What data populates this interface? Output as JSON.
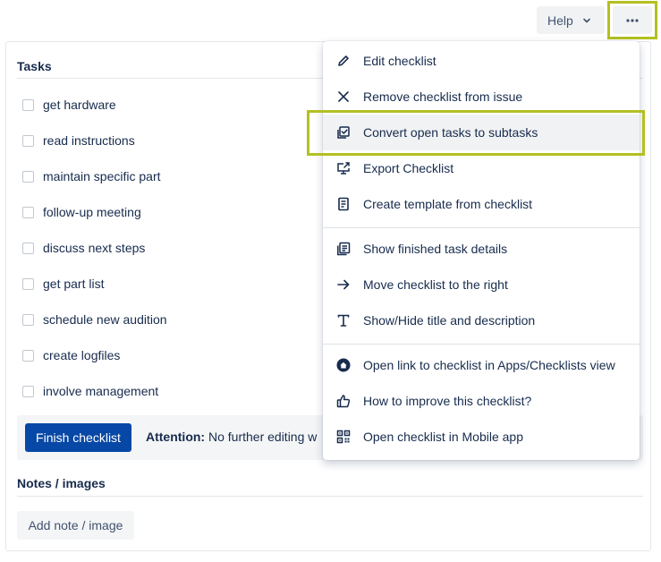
{
  "header": {
    "help_label": "Help",
    "more_icon": "ellipsis-icon"
  },
  "checklist": {
    "tasks_title": "Tasks",
    "tasks": [
      {
        "label": "get hardware",
        "checked": false
      },
      {
        "label": "read instructions",
        "checked": false
      },
      {
        "label": "maintain specific part",
        "checked": false
      },
      {
        "label": "follow-up meeting",
        "checked": false
      },
      {
        "label": "discuss next steps",
        "checked": false
      },
      {
        "label": "get part list",
        "checked": false
      },
      {
        "label": "schedule new audition",
        "checked": false
      },
      {
        "label": "create logfiles",
        "checked": false
      },
      {
        "label": "involve management",
        "checked": false
      }
    ],
    "finish_label": "Finish checklist",
    "attention_label": "Attention:",
    "attention_text": "No further editing w",
    "notes_title": "Notes / images",
    "add_note_label": "Add note / image"
  },
  "menu": {
    "items": [
      {
        "label": "Edit checklist",
        "icon": "pencil-icon"
      },
      {
        "label": "Remove checklist from issue",
        "icon": "close-icon"
      },
      {
        "label": "Convert open tasks to subtasks",
        "icon": "subtasks-icon",
        "highlighted": true
      },
      {
        "label": "Export Checklist",
        "icon": "export-icon"
      },
      {
        "label": "Create template from checklist",
        "icon": "template-icon"
      },
      {
        "label": "Show finished task details",
        "icon": "details-icon"
      },
      {
        "label": "Move checklist to the right",
        "icon": "arrow-right-icon"
      },
      {
        "label": "Show/Hide title and description",
        "icon": "text-icon"
      },
      {
        "label": "Open link to checklist in Apps/Checklists view",
        "icon": "home-icon"
      },
      {
        "label": "How to improve this checklist?",
        "icon": "thumbs-up-icon"
      },
      {
        "label": "Open checklist in Mobile app",
        "icon": "qr-code-icon"
      }
    ]
  },
  "colors": {
    "primary": "#0747a6",
    "highlight_frame": "#b3c022",
    "text": "#172b4d"
  }
}
